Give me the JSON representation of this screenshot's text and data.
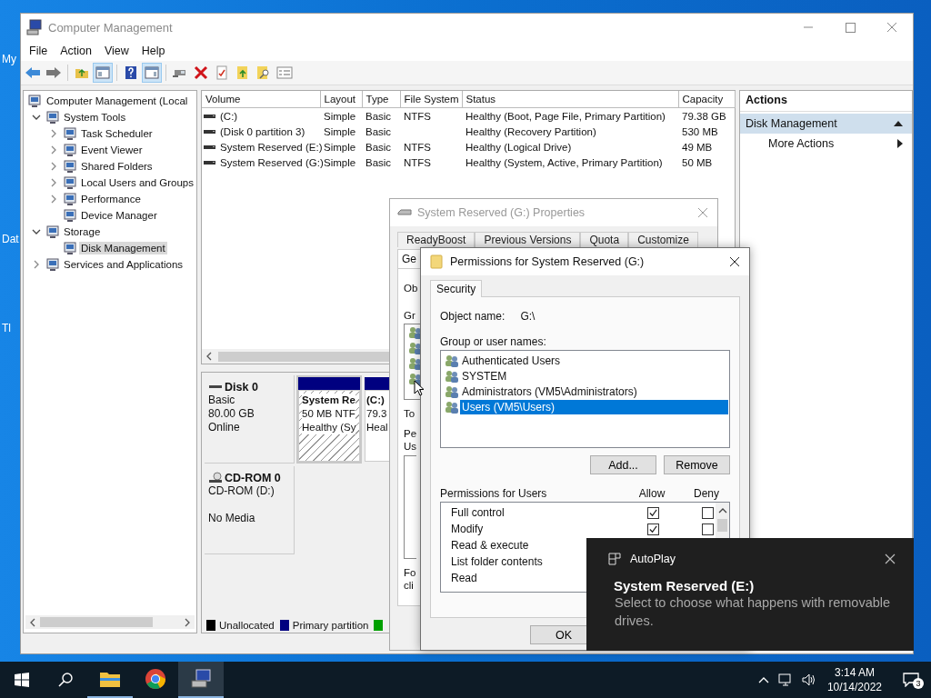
{
  "desktop": {
    "icon_labels": [
      "My",
      "Dat",
      "Tl"
    ]
  },
  "window": {
    "title": "Computer Management",
    "menu": [
      "File",
      "Action",
      "View",
      "Help"
    ],
    "toolbar": [
      {
        "kind": "back",
        "on": false
      },
      {
        "kind": "forward",
        "on": false
      },
      {
        "kind": "sep"
      },
      {
        "kind": "up",
        "on": false
      },
      {
        "kind": "tree",
        "on": true
      },
      {
        "kind": "sep"
      },
      {
        "kind": "help",
        "on": false
      },
      {
        "kind": "pane",
        "on": true
      },
      {
        "kind": "sep"
      },
      {
        "kind": "connect",
        "on": false
      },
      {
        "kind": "delete",
        "on": false
      },
      {
        "kind": "properties",
        "on": false
      },
      {
        "kind": "export",
        "on": false
      },
      {
        "kind": "find",
        "on": false
      },
      {
        "kind": "list",
        "on": false
      }
    ]
  },
  "tree": [
    {
      "label": "Computer Management (Local",
      "selected": false,
      "children": [
        {
          "label": "System Tools",
          "expanded": true,
          "selected": false,
          "children": [
            {
              "label": "Task Scheduler",
              "expanded": false,
              "selected": false
            },
            {
              "label": "Event Viewer",
              "expanded": false,
              "selected": false
            },
            {
              "label": "Shared Folders",
              "expanded": false,
              "selected": false
            },
            {
              "label": "Local Users and Groups",
              "expanded": false,
              "selected": false
            },
            {
              "label": "Performance",
              "expanded": false,
              "selected": false
            },
            {
              "label": "Device Manager",
              "selected": false
            }
          ]
        },
        {
          "label": "Storage",
          "expanded": true,
          "selected": false,
          "children": [
            {
              "label": "Disk Management",
              "selected": true
            }
          ]
        },
        {
          "label": "Services and Applications",
          "expanded": false,
          "selected": false
        }
      ]
    }
  ],
  "volumes": {
    "columns": [
      "Volume",
      "Layout",
      "Type",
      "File System",
      "Status",
      "Capacity"
    ],
    "rows": [
      [
        "(C:)",
        "Simple",
        "Basic",
        "NTFS",
        "Healthy (Boot, Page File, Primary Partition)",
        "79.38 GB"
      ],
      [
        "(Disk 0 partition 3)",
        "Simple",
        "Basic",
        null,
        "Healthy (Recovery Partition)",
        "530 MB"
      ],
      [
        "System Reserved (E:)",
        "Simple",
        "Basic",
        "NTFS",
        "Healthy (Logical Drive)",
        "49 MB"
      ],
      [
        "System Reserved (G:)",
        "Simple",
        "Basic",
        "NTFS",
        "Healthy (System, Active, Primary Partition)",
        "50 MB"
      ]
    ]
  },
  "disks": [
    {
      "kind": "disk",
      "name": "Disk 0",
      "lines": [
        "Basic",
        "80.00 GB",
        "Online"
      ],
      "partitions": [
        {
          "lines": [
            "System Re",
            "50 MB NTF",
            "Healthy (Sy"
          ],
          "selected": true
        },
        {
          "lines": [
            "(C:)",
            "79.3",
            "Heal"
          ],
          "selected": false
        }
      ]
    },
    {
      "kind": "cdrom",
      "name": "CD-ROM 0",
      "lines": [
        "CD-ROM (D:)",
        "No Media"
      ]
    }
  ],
  "legend": [
    {
      "label": "Unallocated",
      "color": "#000000"
    },
    {
      "label": "Primary partition",
      "color": "#000080"
    },
    {
      "color": "#00a000"
    }
  ],
  "actions": {
    "title": "Actions",
    "items": [
      {
        "kind": "header",
        "label": "Disk Management"
      },
      {
        "kind": "submenu",
        "label": "More Actions"
      }
    ]
  },
  "properties": {
    "title": "System Reserved (G:) Properties",
    "tabs": [
      {
        "label": "ReadyBoost",
        "selected": false
      },
      {
        "label": "Previous Versions",
        "selected": false
      },
      {
        "label": "Quota",
        "selected": false
      },
      {
        "label": "Customize",
        "selected": false
      },
      {
        "label": "Ge",
        "selected": true
      }
    ],
    "object_label": "Ob",
    "groups_label": "Gr",
    "hint_label": "To",
    "permissions_label": [
      "Pe",
      "Us"
    ],
    "footer": [
      "Fo",
      "cli"
    ]
  },
  "permissions": {
    "title": "Permissions for System Reserved (G:)",
    "tabs": [
      {
        "label": "Security",
        "selected": true
      }
    ],
    "object_label": "Object name:",
    "object_name": "G:\\",
    "users_label": "Group or user names:",
    "users": [
      {
        "name": "Authenticated Users",
        "selected": false
      },
      {
        "name": "SYSTEM",
        "selected": false
      },
      {
        "name": "Administrators (VM5\\Administrators)",
        "selected": false
      },
      {
        "name": "Users (VM5\\Users)",
        "selected": true
      }
    ],
    "buttons": [
      "Add...",
      "Remove"
    ],
    "perm_label": "Permissions for Users",
    "allow_label": "Allow",
    "deny_label": "Deny",
    "perms": [
      {
        "name": "Full control",
        "allow": true,
        "deny": false
      },
      {
        "name": "Modify",
        "allow": true,
        "deny": false
      },
      {
        "name": "Read & execute"
      },
      {
        "name": "List folder contents"
      },
      {
        "name": "Read"
      }
    ],
    "dialog_buttons": [
      "OK"
    ]
  },
  "toast": {
    "app": "AutoPlay",
    "title": "System Reserved (E:)",
    "body": "Select to choose what happens with removable drives."
  },
  "taskbar": {
    "apps": [
      {
        "kind": "explorer",
        "running": true,
        "active": false
      },
      {
        "kind": "chrome",
        "running": false,
        "active": false
      },
      {
        "kind": "manager",
        "running": true,
        "active": true
      }
    ],
    "time": "3:14 AM",
    "date": "10/14/2022",
    "notifications": "3"
  }
}
